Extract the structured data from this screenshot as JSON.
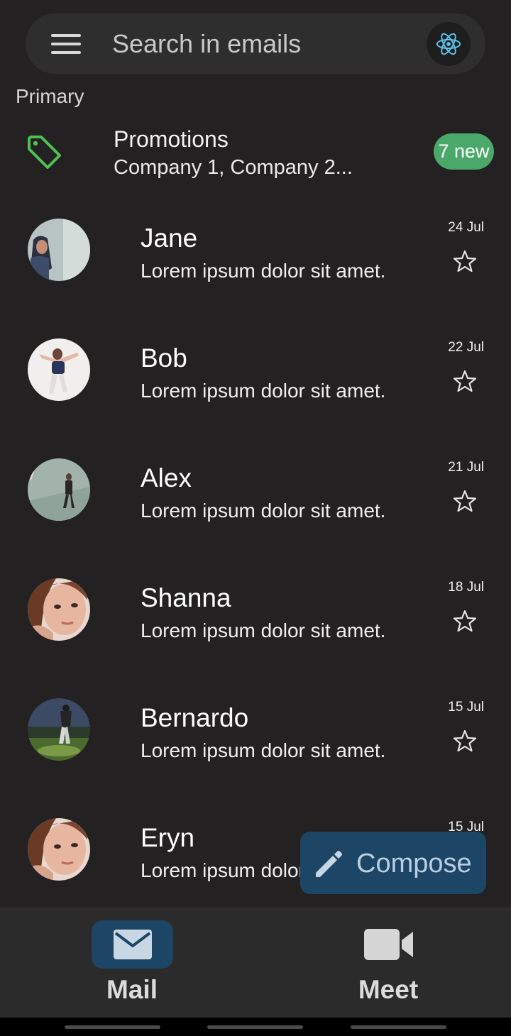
{
  "search": {
    "placeholder": "Search in emails"
  },
  "section": {
    "label": "Primary"
  },
  "promotions": {
    "title": "Promotions",
    "subtitle": "Company 1, Company 2...",
    "badge": "7 new"
  },
  "emails": [
    {
      "sender": "Jane",
      "preview": "Lorem ipsum dolor sit amet.",
      "date": "24 Jul"
    },
    {
      "sender": "Bob",
      "preview": "Lorem ipsum dolor sit amet.",
      "date": "22 Jul"
    },
    {
      "sender": "Alex",
      "preview": "Lorem ipsum dolor sit amet.",
      "date": "21 Jul"
    },
    {
      "sender": "Shanna",
      "preview": "Lorem ipsum dolor sit amet.",
      "date": "18 Jul"
    },
    {
      "sender": "Bernardo",
      "preview": "Lorem ipsum dolor sit amet.",
      "date": "15 Jul"
    },
    {
      "sender": "Eryn",
      "preview": "Lorem ipsum dolor sit amet.",
      "date": "15 Jul"
    }
  ],
  "compose": {
    "label": "Compose"
  },
  "nav": {
    "mail": "Mail",
    "meet": "Meet"
  },
  "colors": {
    "background": "#232122",
    "accent": "#1d4565",
    "badge": "#4aa96a",
    "tag_icon": "#4ec152"
  }
}
